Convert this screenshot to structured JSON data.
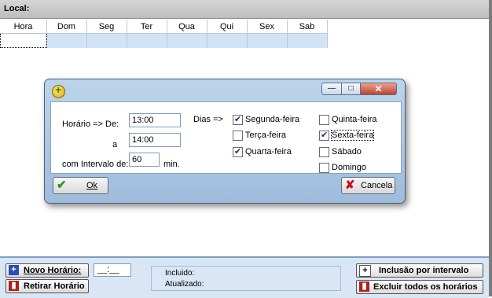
{
  "header": {
    "title": "Local:"
  },
  "grid": {
    "columns": [
      "Hora",
      "Dom",
      "Seg",
      "Ter",
      "Qua",
      "Qui",
      "Sex",
      "Sab"
    ]
  },
  "dialog": {
    "window_buttons": {
      "minimize": "—",
      "maximize": "□",
      "close": "✕"
    },
    "horario_de_label": "Horário => De:",
    "horario_de_value": "13:00",
    "a_label": "a",
    "horario_a_value": "14:00",
    "intervalo_label": "com Intervalo de:",
    "intervalo_value": "60",
    "min_label": "min.",
    "dias_label": "Dias =>",
    "days": [
      {
        "label": "Segunda-feira",
        "checked": true
      },
      {
        "label": "Terça-feira",
        "checked": false
      },
      {
        "label": "Quarta-feira",
        "checked": true
      },
      {
        "label": "Quinta-feira",
        "checked": false
      },
      {
        "label": "Sexta-feira",
        "checked": true
      },
      {
        "label": "Sábado",
        "checked": false
      },
      {
        "label": "Domingo",
        "checked": false
      }
    ],
    "ok_label": "Ok",
    "cancel_label": "Cancela"
  },
  "bottom": {
    "novo_horario_label": "Novo Horário:",
    "time_value": "__:__",
    "retirar_label": "Retirar Horário",
    "incluido_label": "Incluido:",
    "atualizado_label": "Atualizado:",
    "inclusao_label": "Inclusão por intervalo",
    "excluir_label": "Excluir todos os horários"
  },
  "colors": {
    "accent": "#d2e3f5",
    "dialog_frame": "#a9c5e3"
  }
}
